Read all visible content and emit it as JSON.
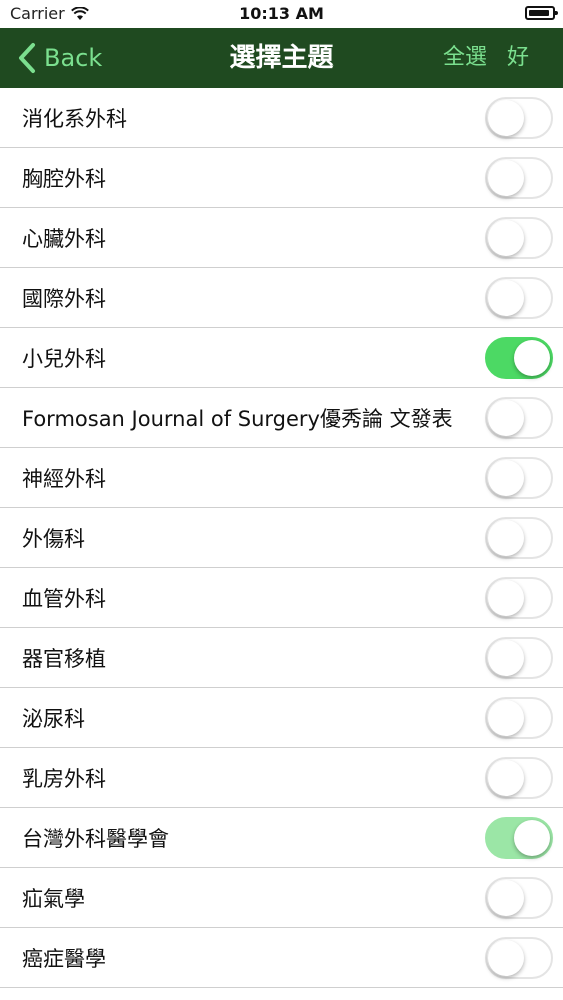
{
  "status_bar": {
    "carrier": "Carrier",
    "time": "10:13 AM"
  },
  "nav": {
    "back_label": "Back",
    "title": "選擇主題",
    "select_all": "全選",
    "done": "好",
    "accent_color": "#7be08f",
    "bar_color": "#1f4a20"
  },
  "topics": [
    {
      "label": "消化系外科",
      "on": false
    },
    {
      "label": "胸腔外科",
      "on": false
    },
    {
      "label": "心臟外科",
      "on": false
    },
    {
      "label": "國際外科",
      "on": false
    },
    {
      "label": "小兒外科",
      "on": true
    },
    {
      "label": "Formosan Journal of Surgery優秀論 文發表",
      "on": false
    },
    {
      "label": "神經外科",
      "on": false
    },
    {
      "label": "外傷科",
      "on": false
    },
    {
      "label": "血管外科",
      "on": false
    },
    {
      "label": "器官移植",
      "on": false
    },
    {
      "label": "泌尿科",
      "on": false
    },
    {
      "label": "乳房外科",
      "on": false
    },
    {
      "label": "台灣外科醫學會",
      "on": true
    },
    {
      "label": "疝氣學",
      "on": false
    },
    {
      "label": "癌症醫學",
      "on": false
    }
  ],
  "colors": {
    "toggle_on": "#4cd964"
  }
}
